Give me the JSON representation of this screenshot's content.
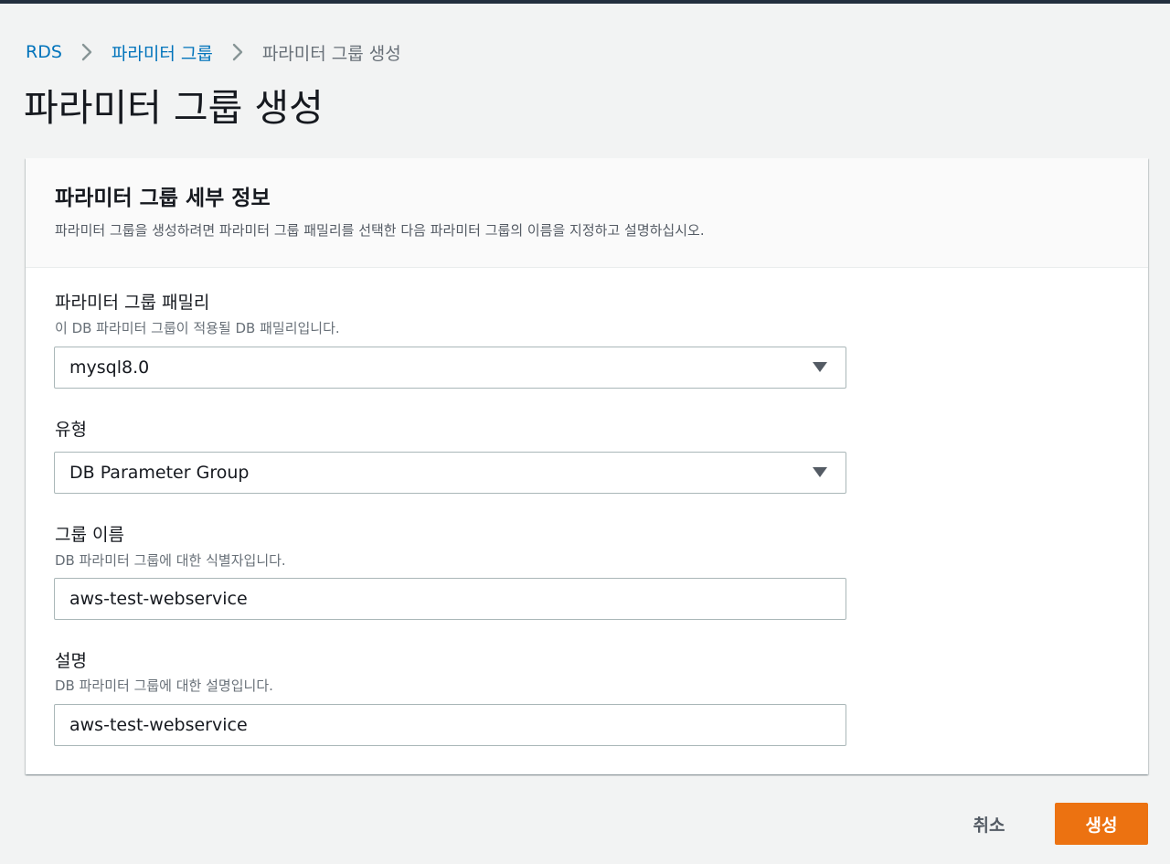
{
  "breadcrumb": {
    "items": [
      "RDS",
      "파라미터 그룹",
      "파라미터 그룹 생성"
    ],
    "separator_icon": "chevron-right-icon"
  },
  "page": {
    "title": "파라미터 그룹 생성"
  },
  "panel": {
    "title": "파라미터 그룹 세부 정보",
    "description": "파라미터 그룹을 생성하려면 파라미터 그룹 패밀리를 선택한 다음 파라미터 그룹의 이름을 지정하고 설명하십시오."
  },
  "fields": {
    "family": {
      "label": "파라미터 그룹 패밀리",
      "description": "이 DB 파라미터 그룹이 적용될 DB 패밀리입니다.",
      "value": "mysql8.0"
    },
    "type": {
      "label": "유형",
      "value": "DB Parameter Group"
    },
    "group_name": {
      "label": "그룹 이름",
      "description": "DB 파라미터 그룹에 대한 식별자입니다.",
      "value": "aws-test-webservice"
    },
    "description": {
      "label": "설명",
      "description": "DB 파라미터 그룹에 대한 설명입니다.",
      "value": "aws-test-webservice"
    }
  },
  "actions": {
    "cancel_label": "취소",
    "create_label": "생성"
  },
  "colors": {
    "accent_link": "#0073bb",
    "primary_button": "#ec7211",
    "background": "#f2f3f3"
  }
}
